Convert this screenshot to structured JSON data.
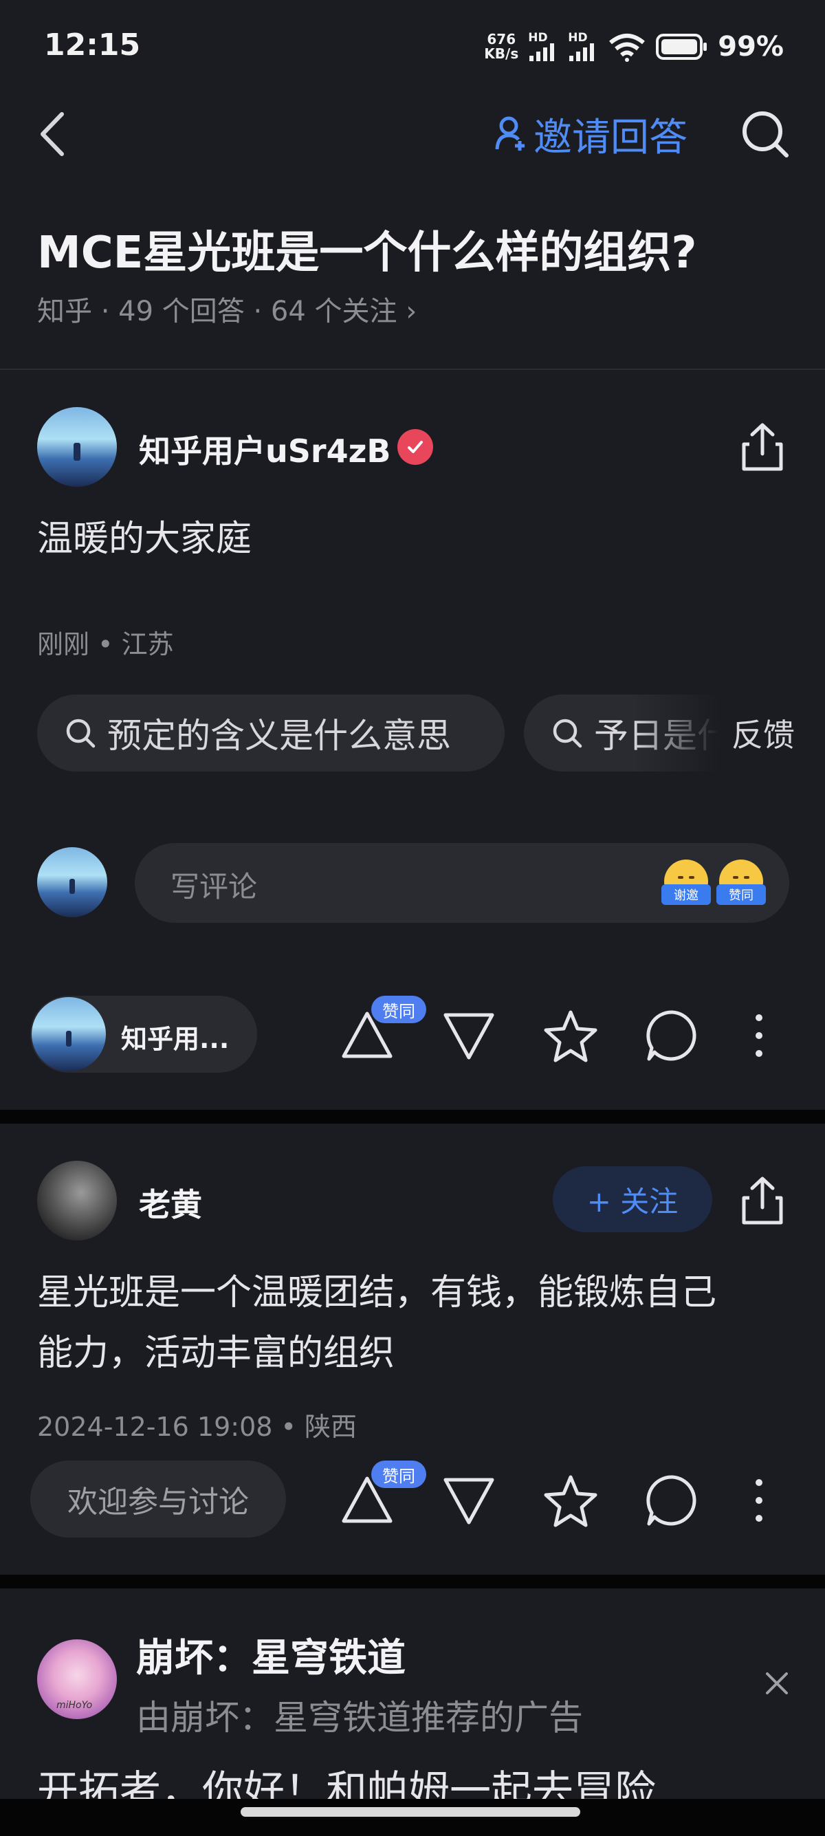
{
  "status_bar": {
    "time": "12:15",
    "net_speed_value": "676",
    "net_speed_unit": "KB/s",
    "signal1_label": "HD",
    "signal2_label": "HD",
    "battery": "99%"
  },
  "nav": {
    "invite_label": "邀请回答"
  },
  "question": {
    "title": "MCE星光班是一个什么样的组织?",
    "meta": "知乎 · 49 个回答 · 64 个关注 ›"
  },
  "answer1": {
    "author": "知乎用户uSr4zB",
    "content": "温暖的大家庭",
    "meta": "刚刚 • 江苏",
    "chips": [
      "预定的含义是什么意思",
      "予日是什"
    ],
    "feedback_label": "反馈",
    "comment_placeholder": "写评论",
    "emoji_tags": [
      "谢邀",
      "赞同"
    ],
    "author_pill": "知乎用...",
    "agree_tag": "赞同"
  },
  "answer2": {
    "author": "老黄",
    "follow_label": "+ 关注",
    "content_line1": "星光班是一个温暖团结，有钱，能锻炼自己",
    "content_line2": "能力，活动丰富的组织",
    "meta": "2024-12-16 19:08 • 陕西",
    "discuss_label": "欢迎参与讨论",
    "agree_tag": "赞同"
  },
  "ad": {
    "title": "崩坏：星穹铁道",
    "subtitle": "由崩坏：星穹铁道推荐的广告",
    "avatar_caption": "miHoYo",
    "text": "开拓者，你好！和帕姆一起去冒险"
  },
  "colors": {
    "background": "#1b1c21",
    "accent": "#4f8cf5",
    "verified_badge": "#e8475b"
  }
}
